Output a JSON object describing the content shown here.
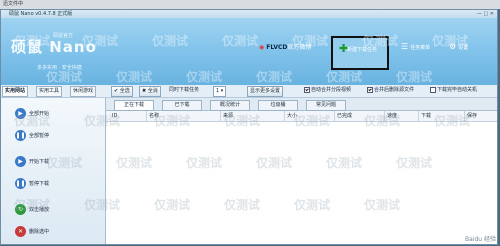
{
  "taskbar_title": "迅文件中",
  "window": {
    "title": "硕鼠 Nano v0.4.7.8 正式版",
    "controls": [
      "—",
      "□",
      "✕"
    ]
  },
  "banner": {
    "logo_cn": "硕鼠",
    "logo_en": "Nano",
    "logo_sub": "硕鼠官方",
    "tagline": "多多实用 · 安全快捷",
    "weibo_prefix": "FLVCD",
    "weibo_suffix": "官方微博",
    "update_label": "新建下载任务",
    "menu_label": "任务菜单",
    "settings_label": "设置"
  },
  "toolbar": {
    "tabs": [
      "实用网站",
      "实用工具",
      "休闲游戏"
    ],
    "buttons": [
      "全选",
      "全消"
    ],
    "concurrent_label": "同时下载任务",
    "concurrent_value": "1",
    "show_more": "显示更多设置",
    "options": [
      {
        "label": "自动合并分段视频",
        "checked": true
      },
      {
        "label": "合并后删除源文件",
        "checked": true
      },
      {
        "label": "下载完毕自动关机",
        "checked": false
      }
    ]
  },
  "sidebar": {
    "buttons": [
      {
        "label": "全部开始",
        "icon": "play-icon",
        "color": "#3a78c8"
      },
      {
        "label": "全部暂停",
        "icon": "pause-icon",
        "color": "#3a78c8"
      },
      {
        "label": "开始下载",
        "icon": "play-icon",
        "color": "#3a78c8"
      },
      {
        "label": "暂停下载",
        "icon": "pause-icon",
        "color": "#3a78c8"
      },
      {
        "label": "双击播放",
        "icon": "refresh-icon",
        "color": "#2c9a3a"
      },
      {
        "label": "删除选中",
        "icon": "delete-icon",
        "color": "#c83a3a"
      }
    ]
  },
  "main": {
    "tabs": [
      "正在下载",
      "已下载",
      "概况统计",
      "垃圾桶",
      "常见问题"
    ],
    "columns": [
      "ID",
      "名称",
      "来源",
      "大小",
      "已完成",
      "速度",
      "下载",
      "保存"
    ]
  },
  "watermark": "仅测试",
  "footer_mark": "Baidu 经验"
}
